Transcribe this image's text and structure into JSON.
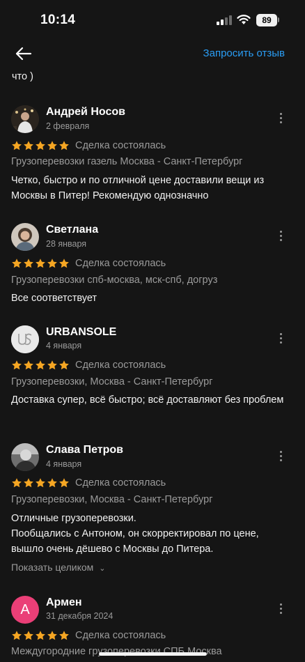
{
  "status": {
    "time": "10:14",
    "battery": "89"
  },
  "header": {
    "request_label": "Запросить отзыв"
  },
  "fragment_text": "что )",
  "reviews": [
    {
      "name": "Андрей Носов",
      "date": "2 февраля",
      "deal": "Сделка состоялась",
      "service": "Грузоперевозки газель Москва - Санкт-Петербург",
      "text": "Четко, быстро и по отличной цене доставили вещи из Москвы в Питер! Рекомендую однозначно"
    },
    {
      "name": "Светлана",
      "date": "28 января",
      "deal": "Сделка состоялась",
      "service": "Грузоперевозки спб-москва, мск-спб, догруз",
      "text": "Все соответствует"
    },
    {
      "name": "URBANSOLE",
      "date": "4 января",
      "deal": "Сделка состоялась",
      "service": "Грузоперевозки, Москва - Санкт-Петербург",
      "text": "Доставка супер, всё быстро; всё доставляют без проблем",
      "avatar_letters": "US"
    },
    {
      "name": "Слава Петров",
      "date": "4 января",
      "deal": "Сделка состоялась",
      "service": "Грузоперевозки, Москва - Санкт-Петербург",
      "text_lines": [
        "Отличные грузоперевозки.",
        "Пообщались с Антоном, он скорректировал по цене, вышло очень дёшево с Москвы до Питера."
      ],
      "expand_label": "Показать целиком"
    },
    {
      "name": "Армен",
      "date": "31 декабря 2024",
      "deal": "Сделка состоялась",
      "service": "Междугородние грузоперевозки СПБ Москва",
      "avatar_letter": "А"
    }
  ],
  "rating": 5,
  "colors": {
    "star": "#f5a623",
    "accent": "#2a9df4",
    "armen_avatar": "#ea3f77"
  }
}
